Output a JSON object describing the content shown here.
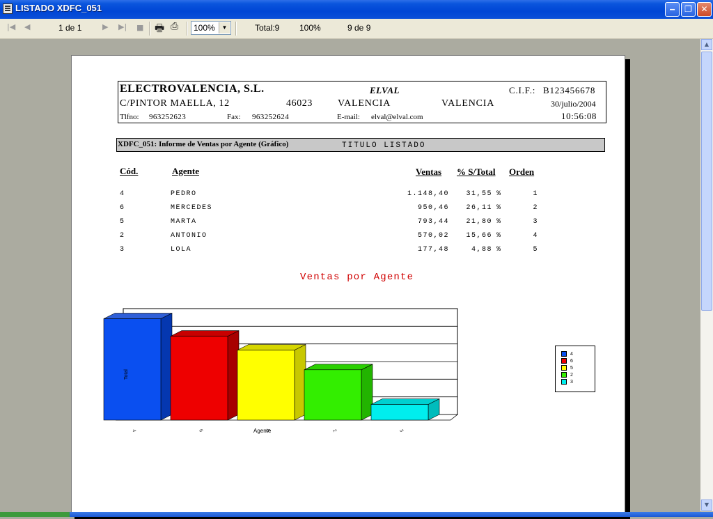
{
  "window": {
    "title": "LISTADO XDFC_051"
  },
  "toolbar": {
    "page_info": "1 de 1",
    "zoom": "100%",
    "total": "Total:9",
    "percent": "100%",
    "records": "9 de 9"
  },
  "company": {
    "name": "ELECTROVALENCIA, S.L.",
    "brand": "ELVAL",
    "cif_label": "C.I.F.:",
    "cif": "B123456678",
    "address": "C/PINTOR MAELLA, 12",
    "zip": "46023",
    "city": "VALENCIA",
    "province": "VALENCIA",
    "date": "30/julio/2004",
    "phone_label": "Tlfno:",
    "phone": "963252623",
    "fax_label": "Fax:",
    "fax": "963252624",
    "email_label": "E-mail:",
    "email": "elval@elval.com",
    "time": "10:56:08"
  },
  "report": {
    "title": "XDFC_051: Informe de Ventas por Agente (Gráfico)",
    "subtitle": "TITULO LISTADO"
  },
  "table": {
    "headers": {
      "code": "Cód.",
      "agent": "Agente",
      "sales": "Ventas",
      "pct": "% S/Total",
      "order": "Orden"
    },
    "rows": [
      {
        "code": "4",
        "agent": "PEDRO",
        "sales": "1.148,40",
        "pct": "31,55",
        "pct_sign": "%",
        "order": "1"
      },
      {
        "code": "6",
        "agent": "MERCEDES",
        "sales": "950,46",
        "pct": "26,11",
        "pct_sign": "%",
        "order": "2"
      },
      {
        "code": "5",
        "agent": "MARTA",
        "sales": "793,44",
        "pct": "21,80",
        "pct_sign": "%",
        "order": "3"
      },
      {
        "code": "2",
        "agent": "ANTONIO",
        "sales": "570,02",
        "pct": "15,66",
        "pct_sign": "%",
        "order": "4"
      },
      {
        "code": "3",
        "agent": "LOLA",
        "sales": "177,48",
        "pct": "4,88",
        "pct_sign": "%",
        "order": "5"
      }
    ]
  },
  "chart_data": {
    "type": "bar",
    "title": "Ventas por Agente",
    "xlabel": "Agente",
    "ylabel": "Total",
    "categories": [
      "4",
      "6",
      "5",
      "2",
      "3"
    ],
    "values": [
      1148.4,
      950.46,
      793.44,
      570.02,
      177.48
    ],
    "ylim": [
      0,
      1200
    ],
    "grid": true,
    "legend_position": "right",
    "colors": [
      "#0a4ff0",
      "#ee0000",
      "#ffff00",
      "#33ee00",
      "#00eeee"
    ],
    "side_colors": [
      "#0537b0",
      "#a80000",
      "#c8c800",
      "#22b400",
      "#00bcbc"
    ],
    "top_colors": [
      "#2f5fd8",
      "#c80000",
      "#d6d600",
      "#2ad000",
      "#00d0d0"
    ]
  },
  "colors": {
    "title_red": "#d00000",
    "titlebar_blue": "#0046d5"
  }
}
